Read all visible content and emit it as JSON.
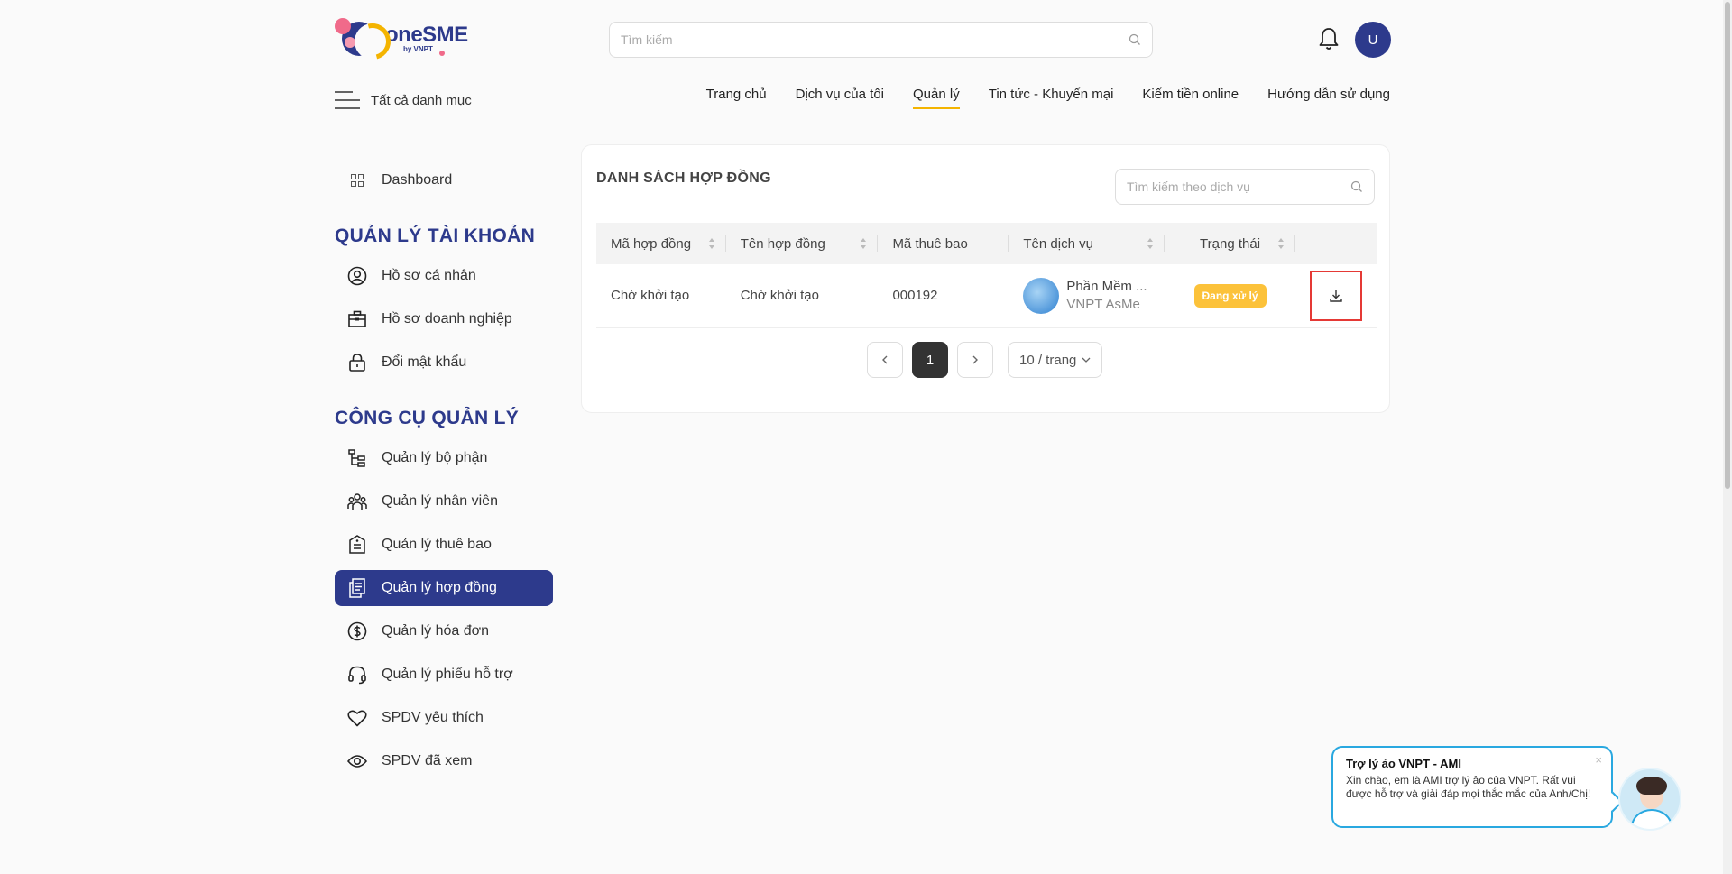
{
  "header": {
    "logo_text": "oneSME",
    "logo_sub": "by VNPT",
    "search_placeholder": "Tìm kiếm",
    "avatar_letter": "U"
  },
  "nav": {
    "all_categories": "Tất cả danh mục",
    "items": [
      {
        "label": "Trang chủ"
      },
      {
        "label": "Dịch vụ của tôi"
      },
      {
        "label": "Quản lý"
      },
      {
        "label": "Tin tức - Khuyến mại"
      },
      {
        "label": "Kiếm tiền online"
      },
      {
        "label": "Hướng dẫn sử dụng"
      }
    ],
    "active_item": "Quản lý"
  },
  "sidebar": {
    "dashboard": "Dashboard",
    "section1_title": "QUẢN LÝ TÀI KHOẢN",
    "section1_items": [
      {
        "label": "Hồ sơ cá nhân"
      },
      {
        "label": "Hồ sơ doanh nghiệp"
      },
      {
        "label": "Đổi mật khẩu"
      }
    ],
    "section2_title": "CÔNG CỤ QUẢN LÝ",
    "section2_items": [
      {
        "label": "Quản lý bộ phận"
      },
      {
        "label": "Quản lý nhân viên"
      },
      {
        "label": "Quản lý thuê bao"
      },
      {
        "label": "Quản lý hợp đồng"
      },
      {
        "label": "Quản lý hóa đơn"
      },
      {
        "label": "Quản lý phiếu hỗ trợ"
      },
      {
        "label": "SPDV yêu thích"
      },
      {
        "label": "SPDV đã xem"
      }
    ],
    "active_item": "Quản lý hợp đồng"
  },
  "main": {
    "title": "DANH SÁCH HỢP ĐỒNG",
    "search_placeholder": "Tìm kiếm theo dịch vụ",
    "columns": [
      "Mã hợp đồng",
      "Tên hợp đồng",
      "Mã thuê bao",
      "Tên dịch vụ",
      "Trạng thái",
      ""
    ],
    "rows": [
      {
        "contract_code": "Chờ khởi tạo",
        "contract_name": "Chờ khởi tạo",
        "subscription_code": "000192",
        "service_name": "Phần Mềm ...",
        "service_provider": "VNPT AsMe",
        "status": "Đang xử lý"
      }
    ],
    "pagination": {
      "current_page": "1",
      "per_page": "10 / trang"
    }
  },
  "chat": {
    "title": "Trợ lý ảo VNPT - AMI",
    "body": "Xin chào, em là AMI trợ lý ảo của VNPT. Rất vui được hỗ trợ và giải đáp mọi thắc mắc của Anh/Chị!",
    "close": "×"
  },
  "colors": {
    "primary": "#2d3a8c",
    "accent": "#f4b400",
    "status_processing": "#fcc23a",
    "highlight": "#e53935"
  }
}
